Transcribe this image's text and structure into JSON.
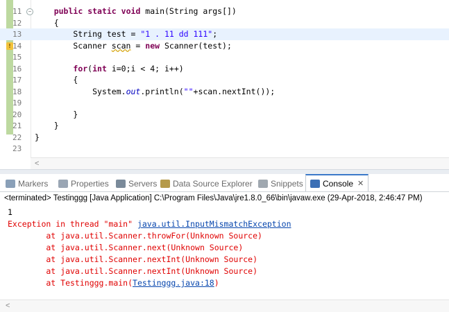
{
  "editor": {
    "lines": [
      {
        "num": "11",
        "parts": [
          {
            "t": "    "
          },
          {
            "t": "public",
            "c": "kw"
          },
          {
            "t": " "
          },
          {
            "t": "static",
            "c": "kw"
          },
          {
            "t": " "
          },
          {
            "t": "void",
            "c": "kw"
          },
          {
            "t": " main(String args[])"
          }
        ],
        "fold": true
      },
      {
        "num": "12",
        "parts": [
          {
            "t": "    {"
          }
        ]
      },
      {
        "num": "13",
        "parts": [
          {
            "t": "        String test = "
          },
          {
            "t": "\"1 . 11 dd 111\"",
            "c": "str"
          },
          {
            "t": ";"
          }
        ],
        "current": true
      },
      {
        "num": "14",
        "parts": [
          {
            "t": "        Scanner "
          },
          {
            "t": "scan",
            "c": "warn-u"
          },
          {
            "t": " = "
          },
          {
            "t": "new",
            "c": "kw"
          },
          {
            "t": " Scanner(test);"
          }
        ],
        "warning": true
      },
      {
        "num": "15",
        "parts": []
      },
      {
        "num": "16",
        "parts": [
          {
            "t": "        "
          },
          {
            "t": "for",
            "c": "kw"
          },
          {
            "t": "("
          },
          {
            "t": "int",
            "c": "kw"
          },
          {
            "t": " i=0;i < 4; i++)"
          }
        ]
      },
      {
        "num": "17",
        "parts": [
          {
            "t": "        {"
          }
        ]
      },
      {
        "num": "18",
        "parts": [
          {
            "t": "            System."
          },
          {
            "t": "out",
            "c": "fld"
          },
          {
            "t": ".println("
          },
          {
            "t": "\"\"",
            "c": "str"
          },
          {
            "t": "+scan.nextInt());"
          }
        ]
      },
      {
        "num": "19",
        "parts": []
      },
      {
        "num": "20",
        "parts": [
          {
            "t": "        }"
          }
        ]
      },
      {
        "num": "21",
        "parts": [
          {
            "t": "    }"
          }
        ]
      },
      {
        "num": "22",
        "parts": [
          {
            "t": "}"
          }
        ]
      },
      {
        "num": "23",
        "parts": []
      }
    ],
    "scroll_left_glyph": "<"
  },
  "tabs": [
    {
      "label": "Markers",
      "icon": "markers-icon",
      "color": "#8aa0b8"
    },
    {
      "label": "Properties",
      "icon": "properties-icon",
      "color": "#9aa6b4"
    },
    {
      "label": "Servers",
      "icon": "servers-icon",
      "color": "#7a8a9a"
    },
    {
      "label": "Data Source Explorer",
      "icon": "data-source-icon",
      "color": "#b59a4a"
    },
    {
      "label": "Snippets",
      "icon": "snippets-icon",
      "color": "#a0a8b0"
    },
    {
      "label": "Console",
      "icon": "console-icon",
      "color": "#3b6fb5",
      "active": true,
      "close": "✕"
    }
  ],
  "console": {
    "header": "<terminated> Testinggg [Java Application] C:\\Program Files\\Java\\jre1.8.0_66\\bin\\javaw.exe (29-Apr-2018, 2:46:47 PM)",
    "lines": [
      {
        "parts": [
          {
            "t": "1",
            "c": "black"
          }
        ]
      },
      {
        "parts": [
          {
            "t": "Exception in thread \"main\" ",
            "c": "red"
          },
          {
            "t": "java.util.InputMismatchException",
            "c": "link"
          }
        ]
      },
      {
        "parts": [
          {
            "t": "\tat java.util.Scanner.throwFor(Unknown Source)",
            "c": "red"
          }
        ]
      },
      {
        "parts": [
          {
            "t": "\tat java.util.Scanner.next(Unknown Source)",
            "c": "red"
          }
        ]
      },
      {
        "parts": [
          {
            "t": "\tat java.util.Scanner.nextInt(Unknown Source)",
            "c": "red"
          }
        ]
      },
      {
        "parts": [
          {
            "t": "\tat java.util.Scanner.nextInt(Unknown Source)",
            "c": "red"
          }
        ]
      },
      {
        "parts": [
          {
            "t": "\tat Testinggg.main(",
            "c": "red"
          },
          {
            "t": "Testinggg.java:18",
            "c": "link"
          },
          {
            "t": ")",
            "c": "red"
          }
        ]
      }
    ],
    "scroll_left_glyph": "<"
  }
}
